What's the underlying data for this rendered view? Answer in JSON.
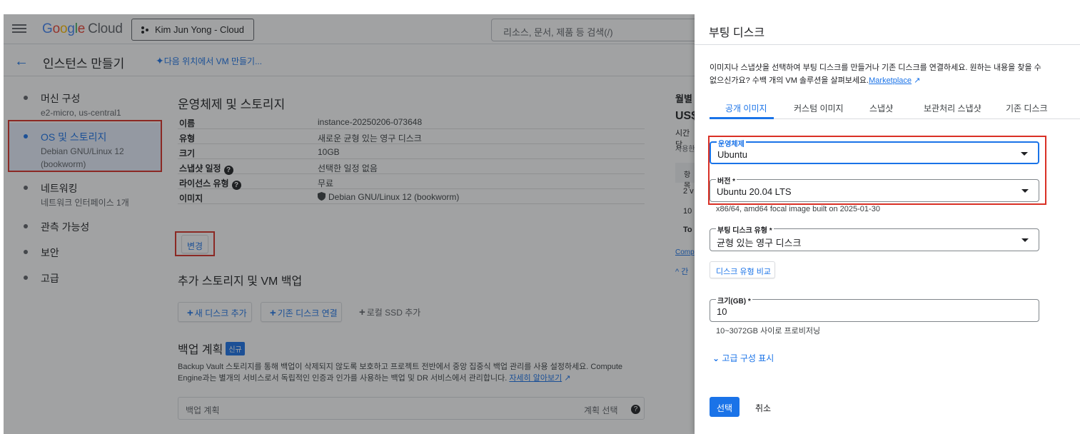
{
  "header": {
    "logo_google": "Google",
    "logo_cloud": "Cloud",
    "project": "Kim Jun Yong - Cloud",
    "search_placeholder": "리소스, 문서, 제품 등 검색(/)"
  },
  "subheader": {
    "title": "인스턴스 만들기",
    "vm_link": "다음 위치에서 VM 만들기..."
  },
  "sidebar": {
    "items": [
      {
        "label": "머신 구성",
        "sub": "e2-micro, us-central1"
      },
      {
        "label": "OS 및 스토리지",
        "sub": "Debian GNU/Linux 12 (bookworm)"
      },
      {
        "label": "네트워킹",
        "sub": "네트워크 인터페이스 1개"
      },
      {
        "label": "관측 가능성",
        "sub": ""
      },
      {
        "label": "보안",
        "sub": ""
      },
      {
        "label": "고급",
        "sub": ""
      }
    ]
  },
  "main": {
    "os_title": "운영체제 및 스토리지",
    "rows": [
      {
        "key": "이름",
        "value": "instance-20250206-073648"
      },
      {
        "key": "유형",
        "value": "새로운 균형 있는 영구 디스크"
      },
      {
        "key": "크기",
        "value": "10GB"
      },
      {
        "key": "스냅샷 일정",
        "value": "선택한 일정 없음"
      },
      {
        "key": "라이선스 유형",
        "value": "무료"
      },
      {
        "key": "이미지",
        "value": "Debian GNU/Linux 12 (bookworm)"
      }
    ],
    "change_button": "변경",
    "storage_title": "추가 스토리지 및 VM 백업",
    "add_disk": "새 디스크 추가",
    "attach_disk": "기존 디스크 연결",
    "local_ssd": "로컬 SSD 추가",
    "backup_title": "백업 계획",
    "backup_badge": "신규",
    "backup_desc": "Backup Vault 스토리지를 통해 백업이 삭제되지 않도록 보호하고 프로젝트 전반에서 중앙 집중식 백업 관리를 사용 설정하세요. Compute Engine과는 별개의 서비스로서 독립적인 인증과 인가를 사용하는 백업 및 DR 서비스에서 관리합니다.",
    "learn_more": "자세히 알아보기",
    "backup_field": "백업 계획",
    "backup_select": "계획 선택"
  },
  "right_peek": {
    "l1": "월별",
    "l2": "US$",
    "l3": "시간당",
    "l4": "사용한",
    "l5": "항목",
    "l6": "2 v",
    "l7": "10",
    "l8": "To",
    "l9": "Comp",
    "l10": "^ 간"
  },
  "panel": {
    "title": "부팅 디스크",
    "desc": "이미지나 스냅샷을 선택하여 부팅 디스크를 만들거나 기존 디스크를 연결하세요. 원하는 내용을 찾을 수 없으신가요? 수백 개의 VM 솔루션을 살펴보세요.",
    "marketplace": "Marketplace",
    "tabs": [
      "공개 이미지",
      "커스텀 이미지",
      "스냅샷",
      "보관처리 스냅샷",
      "기존 디스크"
    ],
    "os_label": "운영체제",
    "os_value": "Ubuntu",
    "version_label": "버전 *",
    "version_value": "Ubuntu 20.04 LTS",
    "version_hint": "x86/64, amd64 focal image built on 2025-01-30",
    "disktype_label": "부팅 디스크 유형 *",
    "disktype_value": "균형 있는 영구 디스크",
    "compare_button": "디스크 유형 비교",
    "size_label": "크기(GB) *",
    "size_value": "10",
    "size_hint": "10~3072GB 사이로 프로비저닝",
    "advanced": "고급 구성 표시",
    "select_button": "선택",
    "cancel_button": "취소"
  },
  "colors": {
    "accent": "#1a73e8",
    "highlight": "#d93025"
  }
}
